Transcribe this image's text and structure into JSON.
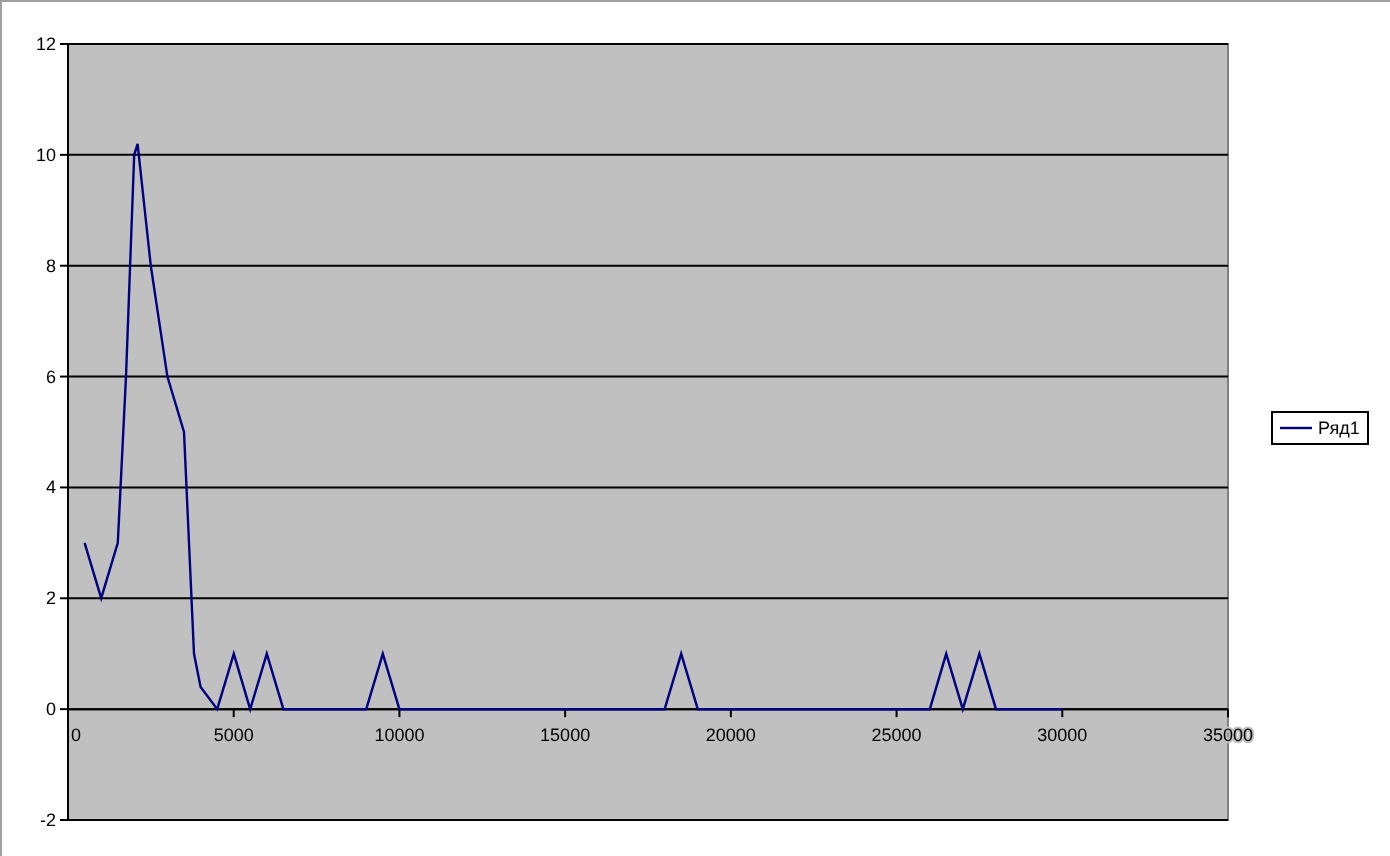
{
  "chart_data": {
    "type": "line",
    "x": [
      500,
      1000,
      1500,
      1750,
      2000,
      2100,
      2500,
      3000,
      3500,
      3800,
      4000,
      4500,
      5000,
      5500,
      6000,
      6500,
      7000,
      9000,
      9500,
      10000,
      10500,
      18000,
      18500,
      19000,
      19500,
      26000,
      26500,
      27000,
      27500,
      28000,
      30000
    ],
    "series": [
      {
        "name": "Ряд1",
        "color": "#000080",
        "values": [
          3,
          2,
          3,
          6,
          10,
          10.2,
          8,
          6,
          5,
          1,
          0.4,
          0,
          1,
          0,
          1,
          0,
          0,
          0,
          1,
          0,
          0,
          0,
          1,
          0,
          0,
          0,
          1,
          0,
          1,
          0,
          0
        ]
      }
    ],
    "xlim": [
      0,
      35000
    ],
    "ylim": [
      -2,
      12
    ],
    "xticks": [
      0,
      5000,
      10000,
      15000,
      20000,
      25000,
      30000,
      35000
    ],
    "yticks": [
      -2,
      0,
      2,
      4,
      6,
      8,
      10,
      12
    ],
    "grid": true
  }
}
